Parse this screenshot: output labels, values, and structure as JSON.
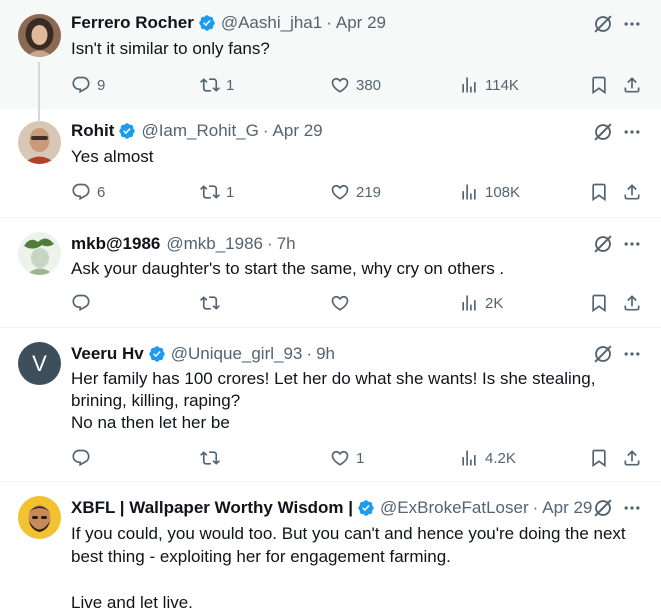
{
  "tweets": [
    {
      "name": "Ferrero Rocher",
      "verified": true,
      "handle": "@Aashi_jha1",
      "time": "Apr 29",
      "text": "Isn't it similar to only fans?",
      "replies": "9",
      "reposts": "1",
      "likes": "380",
      "views": "114K",
      "highlighted": true
    },
    {
      "name": "Rohit",
      "verified": true,
      "handle": "@Iam_Rohit_G",
      "time": "Apr 29",
      "text": "Yes almost",
      "replies": "6",
      "reposts": "1",
      "likes": "219",
      "views": "108K"
    },
    {
      "name": "mkb@1986",
      "verified": false,
      "handle": "@mkb_1986",
      "time": "7h",
      "text": "Ask your daughter's to start the same, why cry on others .",
      "replies": "",
      "reposts": "",
      "likes": "",
      "views": "2K"
    },
    {
      "name": "Veeru Hv",
      "verified": true,
      "avatar_letter": "V",
      "handle": "@Unique_girl_93",
      "time": "9h",
      "text": "Her family has 100 crores! Let her do what she wants! Is she stealing, brining, killing, raping?\nNo na then let her be",
      "replies": "",
      "reposts": "",
      "likes": "1",
      "views": "4.2K"
    },
    {
      "name": "XBFL | Wallpaper Worthy Wisdom |",
      "verified": true,
      "handle": "@ExBrokeFatLoser",
      "time": "Apr 29",
      "text": "If you could, you would too. But you can't and hence you're doing the next best thing - exploiting her for engagement farming.\n\nLive and let live."
    }
  ],
  "icons": {
    "reply": "reply-icon",
    "repost": "repost-icon",
    "like": "like-icon",
    "views": "views-icon",
    "bookmark": "bookmark-icon",
    "share": "share-icon",
    "grok": "grok-icon",
    "more": "more-icon",
    "verified": "verified-badge-icon"
  },
  "colors": {
    "text": "#0f1419",
    "secondary": "#536471",
    "verified_blue": "#1d9bf0",
    "highlight_bg": "#f7f9f9",
    "separator": "#eff3f4",
    "thread_line": "#cfd9de"
  }
}
